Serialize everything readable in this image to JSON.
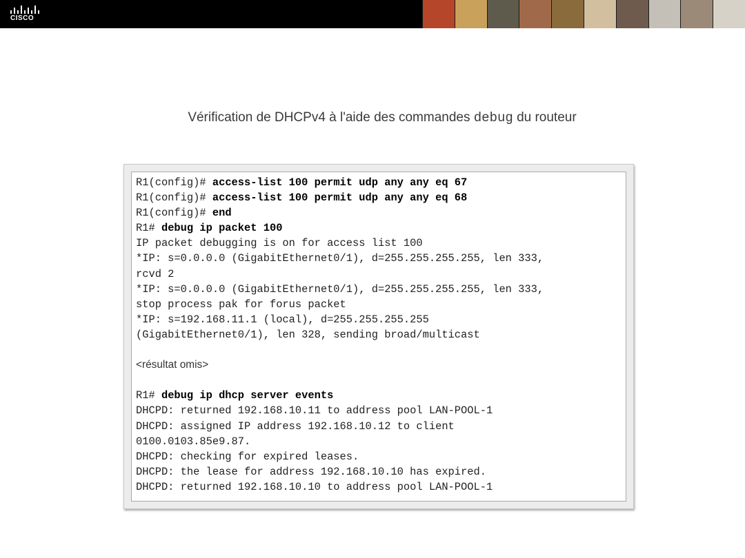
{
  "header": {
    "logo_text": "CISCO",
    "logo_icon": "cisco-bars-icon",
    "photo_colors": [
      "#b5462a",
      "#c9a15a",
      "#5e5a4c",
      "#a06a4a",
      "#8a6b3c",
      "#d2bfa0",
      "#6f5b4d",
      "#c4c0b8",
      "#9b8a78",
      "#d6d2c8"
    ]
  },
  "title": {
    "prefix": "Vérification de DHCPv4 à l'aide des commandes",
    "command": "debug",
    "suffix": "du routeur"
  },
  "code": {
    "lines": [
      {
        "prompt": "R1(config)# ",
        "command": "access-list 100 permit udp any any eq 67"
      },
      {
        "prompt": "R1(config)# ",
        "command": "access-list 100 permit udp any any eq 68"
      },
      {
        "prompt": "R1(config)# ",
        "command": "end"
      },
      {
        "prompt": "R1# ",
        "command": "debug ip packet 100"
      },
      {
        "text": "IP packet debugging is on for access list 100"
      },
      {
        "text": "*IP: s=0.0.0.0 (GigabitEthernet0/1), d=255.255.255.255, len 333,"
      },
      {
        "text": "rcvd 2"
      },
      {
        "text": "*IP: s=0.0.0.0 (GigabitEthernet0/1), d=255.255.255.255, len 333,"
      },
      {
        "text": "stop process pak for forus packet"
      },
      {
        "text": "*IP: s=192.168.11.1 (local), d=255.255.255.255"
      },
      {
        "text": "(GigabitEthernet0/1), len 328, sending broad/multicast"
      },
      {
        "blank": true
      },
      {
        "omitted": "<résultat omis>"
      },
      {
        "blank": true
      },
      {
        "prompt": "R1# ",
        "command": "debug ip dhcp server events"
      },
      {
        "text": "DHCPD: returned 192.168.10.11 to address pool LAN-POOL-1"
      },
      {
        "text": "DHCPD: assigned IP address 192.168.10.12 to client"
      },
      {
        "text": "0100.0103.85e9.87."
      },
      {
        "text": "DHCPD: checking for expired leases."
      },
      {
        "text": "DHCPD: the lease for address 192.168.10.10 has expired."
      },
      {
        "text": "DHCPD: returned 192.168.10.10 to address pool LAN-POOL-1"
      }
    ]
  }
}
